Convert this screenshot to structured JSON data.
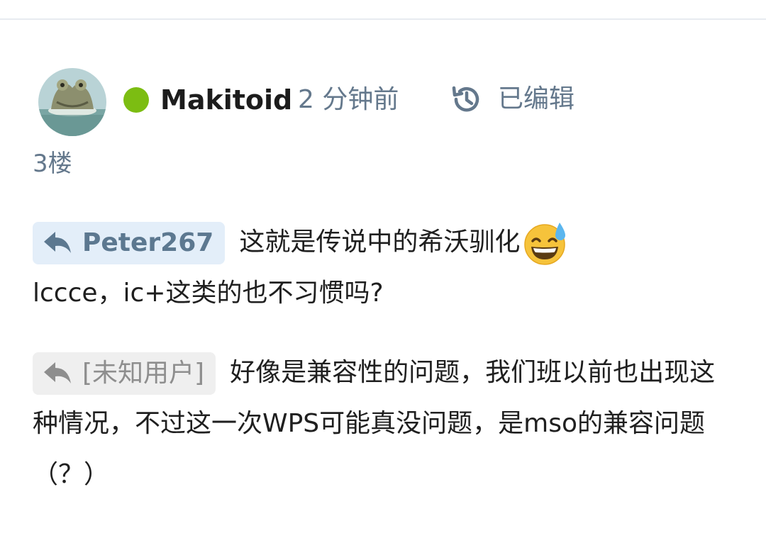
{
  "post": {
    "username": "Makitoid",
    "timestamp": "2 分钟前",
    "edited_label": "已编辑",
    "floor": "3楼",
    "online_color": "#7cbd12",
    "icons": {
      "avatar": "avatar-image",
      "online": "online-status-dot",
      "edited": "history-icon",
      "reply": "reply-arrow-icon",
      "emoji": "grinning-sweat-emoji"
    },
    "replies": [
      {
        "target": "Peter267",
        "text_line1": "这就是传说中的希沃驯化",
        "text_line2": "lccce，ic+这类的也不习惯吗?"
      },
      {
        "target": "[未知用户]",
        "text": "好像是兼容性的问题，我们班以前也出现这种情况，不过这一次WPS可能真没问题，是mso的兼容问题（？）"
      }
    ]
  }
}
